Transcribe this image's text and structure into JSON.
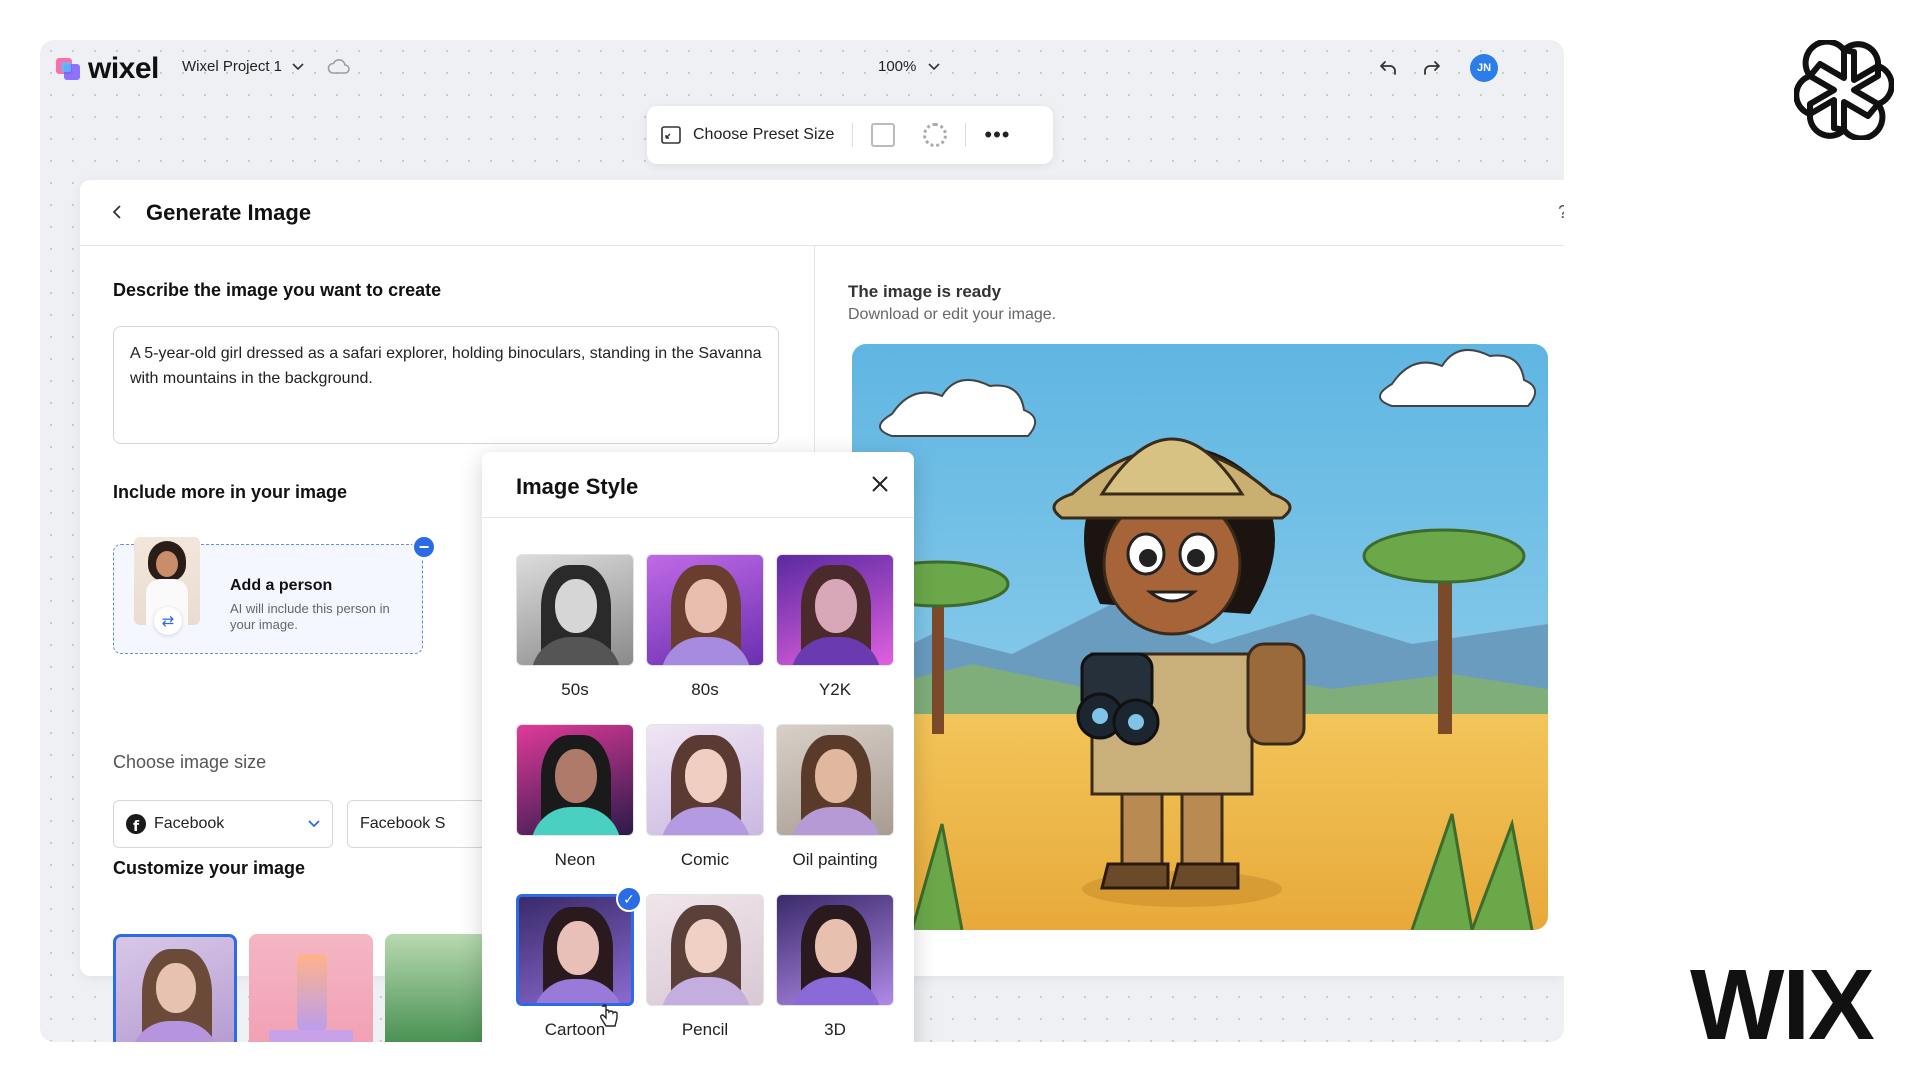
{
  "app": {
    "logo_text": "wixel",
    "project_name": "Wixel Project 1",
    "zoom": "100%",
    "user_initials": "JN"
  },
  "toolbar": {
    "preset_label": "Choose Preset Size"
  },
  "panel": {
    "title": "Generate Image",
    "prompt_label": "Describe the image you want to create",
    "prompt_text": "A 5-year-old girl dressed as a safari explorer, holding binoculars, standing in the Savanna with mountains in the background.",
    "include_label": "Include more in your image",
    "person": {
      "title": "Add a person",
      "description": "AI will include this person in your image."
    },
    "size_label": "Choose image size",
    "size_select": "Facebook",
    "size_select_2": "Facebook S",
    "customize_label": "Customize your image"
  },
  "result": {
    "title": "The image is ready",
    "subtitle": "Download or edit your image."
  },
  "style_modal": {
    "title": "Image Style",
    "styles": [
      {
        "label": "50s",
        "selected": false
      },
      {
        "label": "80s",
        "selected": false
      },
      {
        "label": "Y2K",
        "selected": false
      },
      {
        "label": "Neon",
        "selected": false
      },
      {
        "label": "Comic",
        "selected": false
      },
      {
        "label": "Oil painting",
        "selected": false
      },
      {
        "label": "Cartoon",
        "selected": true
      },
      {
        "label": "Pencil",
        "selected": false
      },
      {
        "label": "3D",
        "selected": false
      }
    ]
  },
  "branding": {
    "corner_logo": "WIX"
  },
  "colors": {
    "accent": "#2b6be3",
    "avatar": "#2b7de9"
  }
}
